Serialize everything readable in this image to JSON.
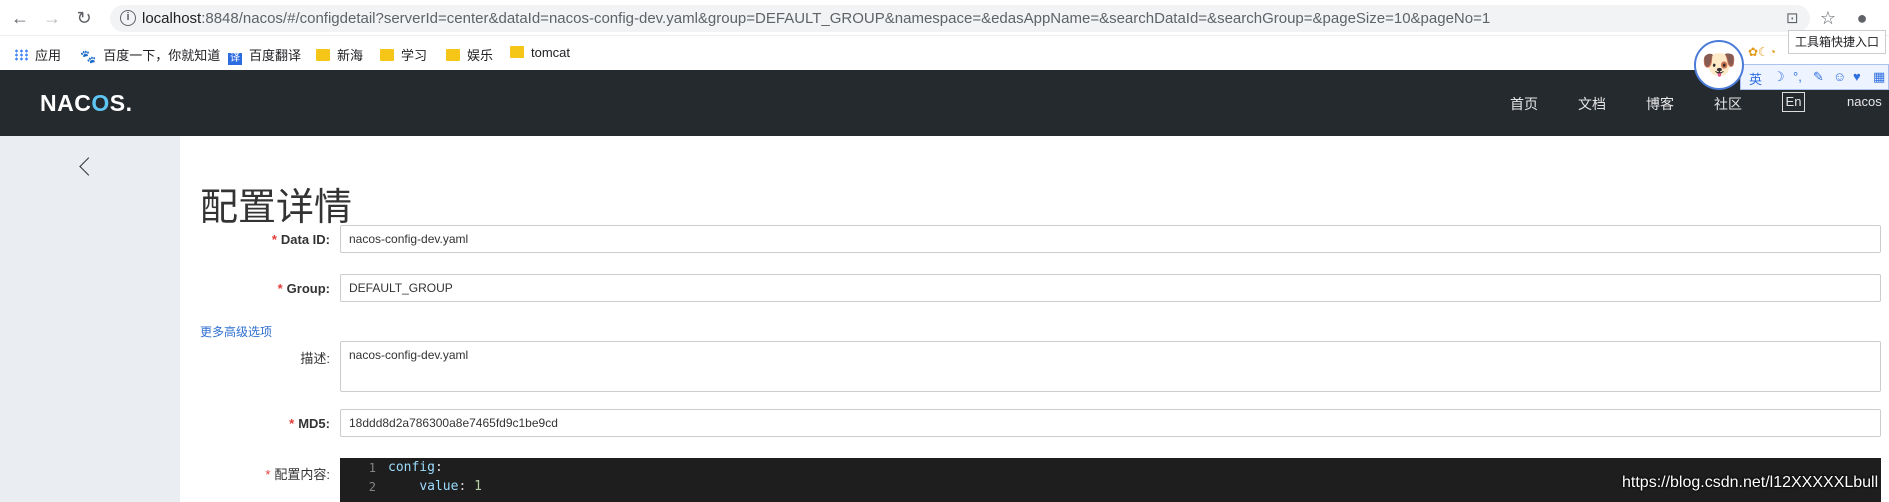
{
  "browser": {
    "url_host": "localhost",
    "url_rest": ":8848/nacos/#/configdetail?serverId=center&dataId=nacos-config-dev.yaml&group=DEFAULT_GROUP&namespace=&edasAppName=&searchDataId=&searchGroup=&pageSize=10&pageNo=1",
    "back_icon": "←",
    "forward_icon": "→",
    "reload_icon": "↻",
    "info_icon": "i",
    "translate_icon": "⊡",
    "star_icon": "☆",
    "account_icon": "●"
  },
  "bookmarks": [
    {
      "label": "应用",
      "icon": "apps-grid-icon"
    },
    {
      "label": "百度一下，你就知道",
      "icon": "baidu-paw-icon"
    },
    {
      "label": "百度翻译",
      "icon": "translate-icon"
    },
    {
      "label": "新海",
      "icon": "folder-icon"
    },
    {
      "label": "学习",
      "icon": "folder-icon"
    },
    {
      "label": "娱乐",
      "icon": "folder-icon"
    },
    {
      "label": "tomcat",
      "icon": "folder-icon"
    }
  ],
  "extension": {
    "tooltip": "工具箱快捷入口",
    "mascot": "🐶",
    "mini_icons": "✿☾◔",
    "panel_lang": "英",
    "panel_icons": [
      "☽",
      "°,",
      "✎",
      "☺",
      "♥",
      "▦"
    ]
  },
  "header": {
    "logo_pre": "NAC",
    "logo_o": "O",
    "logo_post": "S.",
    "nav": [
      "首页",
      "文档",
      "博客",
      "社区"
    ],
    "lang": "En",
    "user": "nacos"
  },
  "page": {
    "title": "配置详情",
    "data_id_label": "Data ID:",
    "data_id_value": "nacos-config-dev.yaml",
    "group_label": "Group:",
    "group_value": "DEFAULT_GROUP",
    "advanced_link": "更多高级选项",
    "desc_label": "描述:",
    "desc_value": "nacos-config-dev.yaml",
    "md5_label": "MD5:",
    "md5_value": "18ddd8d2a786300a8e7465fd9c1be9cd",
    "content_label": "配置内容:",
    "required_mark": "*"
  },
  "editor": {
    "lines": [
      {
        "num": "1",
        "key": "config",
        "sep": ":",
        "value": ""
      },
      {
        "num": "2",
        "key": "value",
        "sep": ": ",
        "value": "1"
      }
    ]
  },
  "watermark": "https://blog.csdn.net/l12XXXXXLbull"
}
